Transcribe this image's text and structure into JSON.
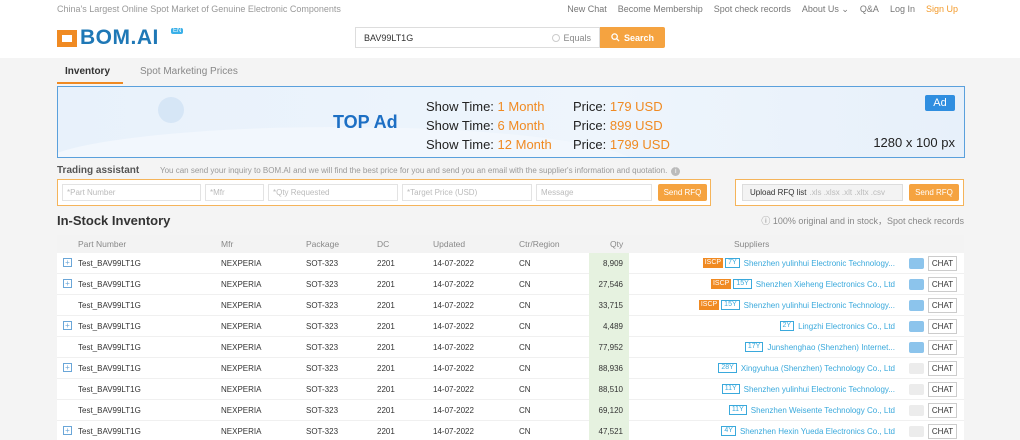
{
  "topbar": {
    "slogan": "China's Largest Online Spot Market of Genuine Electronic Components",
    "links": [
      "New Chat",
      "Become Membership",
      "Spot check records",
      "About Us",
      "Q&A",
      "Log In",
      "Sign Up"
    ]
  },
  "header": {
    "logo_text": "BOM",
    "logo_suffix": ".AI",
    "logo_badge": "EN",
    "search_value": "BAV99LT1G",
    "equals_label": "Equals",
    "search_button": "Search"
  },
  "tabs": [
    "Inventory",
    "Spot Marketing Prices"
  ],
  "ad": {
    "title": "TOP Ad",
    "badge": "Ad",
    "size": "1280 x 100 px",
    "rows": [
      {
        "time_label": "Show Time:",
        "time": "1 Month",
        "price_label": "Price:",
        "price": "179 USD"
      },
      {
        "time_label": "Show Time:",
        "time": "6 Month",
        "price_label": "Price:",
        "price": "899 USD"
      },
      {
        "time_label": "Show Time:",
        "time": "12 Month",
        "price_label": "Price:",
        "price": "1799 USD"
      }
    ]
  },
  "trading_assistant": {
    "title": "Trading assistant",
    "description": "You can send your inquiry to BOM.AI and we will find the best price for you and send you an email with the supplier's information and quotation.",
    "placeholders": {
      "part_number": "*Part Number",
      "mfr": "*Mfr",
      "qty": "*Qty Requested",
      "target_price": "*Target Price (USD)",
      "message": "Message"
    },
    "send_button": "Send RFQ",
    "upload_label": "Upload RFQ list",
    "upload_ext": ".xls .xlsx .xlt .xltx .csv",
    "upload_send_button": "Send RFQ"
  },
  "instock": {
    "title": "In-Stock Inventory",
    "note": "100% original and in stock，Spot check records"
  },
  "table": {
    "columns": [
      "Part Number",
      "Mfr",
      "Package",
      "DC",
      "Updated",
      "Ctr/Region",
      "Qty",
      "Suppliers"
    ],
    "rows": [
      {
        "expand": true,
        "part": "Test_BAV99LT1G",
        "mfr": "NEXPERIA",
        "package": "SOT-323",
        "dc": "2201",
        "updated": "14-07-2022",
        "region": "CN",
        "qty": "8,909",
        "iscp": "ISCP",
        "years": "7Y",
        "supplier": "Shenzhen yulinhui Electronic Technology...",
        "mail": true,
        "chat": "CHAT"
      },
      {
        "expand": true,
        "part": "Test_BAV99LT1G",
        "mfr": "NEXPERIA",
        "package": "SOT-323",
        "dc": "2201",
        "updated": "14-07-2022",
        "region": "CN",
        "qty": "27,546",
        "iscp": "ISCP",
        "years": "15Y",
        "supplier": "Shenzhen Xieheng Electronics Co., Ltd",
        "mail": true,
        "chat": "CHAT"
      },
      {
        "expand": false,
        "part": "Test_BAV99LT1G",
        "mfr": "NEXPERIA",
        "package": "SOT-323",
        "dc": "2201",
        "updated": "14-07-2022",
        "region": "CN",
        "qty": "33,715",
        "iscp": "ISCP",
        "years": "15Y",
        "supplier": "Shenzhen yulinhui Electronic Technology...",
        "mail": true,
        "chat": "CHAT"
      },
      {
        "expand": true,
        "part": "Test_BAV99LT1G",
        "mfr": "NEXPERIA",
        "package": "SOT-323",
        "dc": "2201",
        "updated": "14-07-2022",
        "region": "CN",
        "qty": "4,489",
        "iscp": "",
        "years": "2Y",
        "supplier": "Lingzhi Electronics Co., Ltd",
        "mail": true,
        "chat": "CHAT"
      },
      {
        "expand": false,
        "part": "Test_BAV99LT1G",
        "mfr": "NEXPERIA",
        "package": "SOT-323",
        "dc": "2201",
        "updated": "14-07-2022",
        "region": "CN",
        "qty": "77,952",
        "iscp": "",
        "years": "17Y",
        "supplier": "Junshenghao (Shenzhen) Internet...",
        "mail": true,
        "chat": "CHAT"
      },
      {
        "expand": true,
        "part": "Test_BAV99LT1G",
        "mfr": "NEXPERIA",
        "package": "SOT-323",
        "dc": "2201",
        "updated": "14-07-2022",
        "region": "CN",
        "qty": "88,936",
        "iscp": "",
        "years": "28Y",
        "supplier": "Xingyuhua (Shenzhen) Technology Co., Ltd",
        "mail": false,
        "chat": "CHAT"
      },
      {
        "expand": false,
        "part": "Test_BAV99LT1G",
        "mfr": "NEXPERIA",
        "package": "SOT-323",
        "dc": "2201",
        "updated": "14-07-2022",
        "region": "CN",
        "qty": "88,510",
        "iscp": "",
        "years": "11Y",
        "supplier": "Shenzhen yulinhui Electronic Technology...",
        "mail": false,
        "chat": "CHAT"
      },
      {
        "expand": false,
        "part": "Test_BAV99LT1G",
        "mfr": "NEXPERIA",
        "package": "SOT-323",
        "dc": "2201",
        "updated": "14-07-2022",
        "region": "CN",
        "qty": "69,120",
        "iscp": "",
        "years": "11Y",
        "supplier": "Shenzhen Weisente Technology Co., Ltd",
        "mail": false,
        "chat": "CHAT"
      },
      {
        "expand": true,
        "part": "Test_BAV99LT1G",
        "mfr": "NEXPERIA",
        "package": "SOT-323",
        "dc": "2201",
        "updated": "14-07-2022",
        "region": "CN",
        "qty": "47,521",
        "iscp": "",
        "years": "4Y",
        "supplier": "Shenzhen Hexin Yueda Electronics Co., Ltd",
        "mail": false,
        "chat": "CHAT"
      }
    ]
  },
  "colors": {
    "accent": "#f08a22",
    "brand_blue": "#1f78b6",
    "link_blue": "#3aa9dc",
    "qty_bg": "#e6f2e0"
  }
}
